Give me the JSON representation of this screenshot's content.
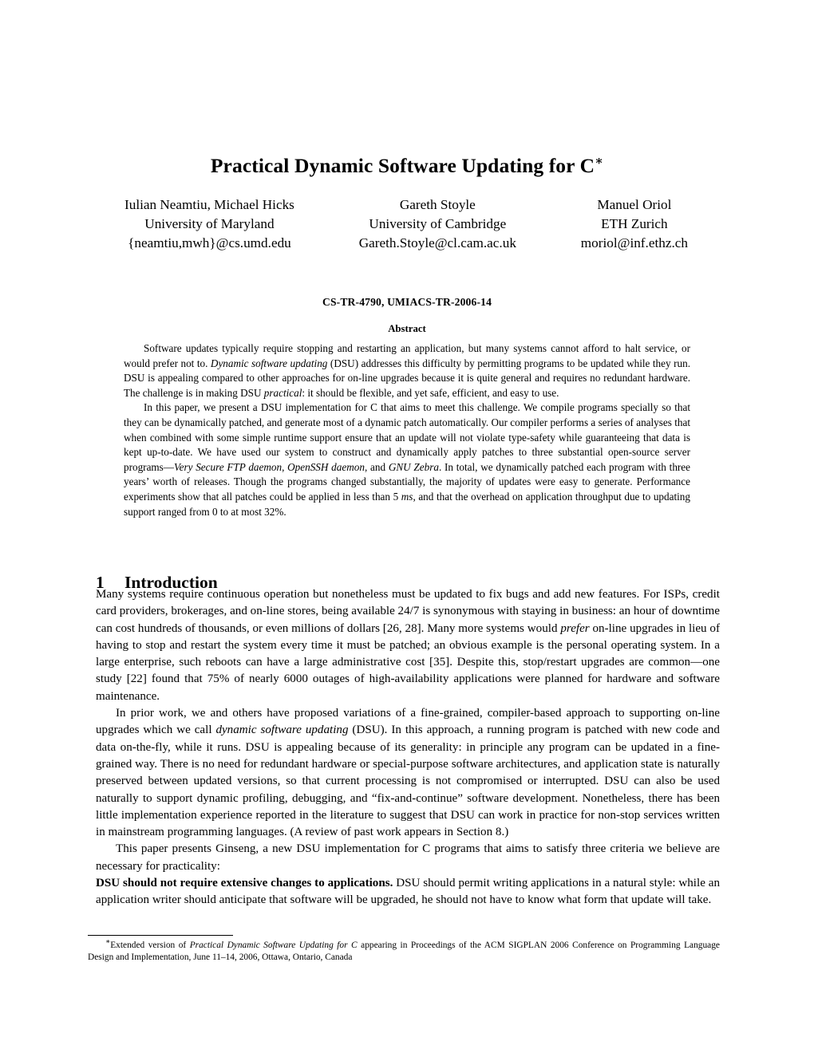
{
  "paper": {
    "title": "Practical Dynamic Software Updating for C",
    "title_footnote_marker": "∗",
    "authors": [
      {
        "names": "Iulian Neamtiu, Michael Hicks",
        "affiliation": "University of Maryland",
        "email": "{neamtiu,mwh}@cs.umd.edu"
      },
      {
        "names": "Gareth Stoyle",
        "affiliation": "University of Cambridge",
        "email": "Gareth.Stoyle@cl.cam.ac.uk"
      },
      {
        "names": "Manuel Oriol",
        "affiliation": "ETH Zurich",
        "email": "moriol@inf.ethz.ch"
      }
    ],
    "report_number": "CS-TR-4790, UMIACS-TR-2006-14",
    "abstract_heading": "Abstract",
    "abstract_paragraphs": [
      "Software updates typically require stopping and restarting an application, but many systems cannot afford to halt service, or would prefer not to. <i>Dynamic software updating</i> (DSU) addresses this difficulty by permitting programs to be updated while they run. DSU is appealing compared to other approaches for on-line upgrades because it is quite general and requires no redundant hardware. The challenge is in making DSU <i>practical</i>: it should be flexible, and yet safe, efficient, and easy to use.",
      "In this paper, we present a DSU implementation for C that aims to meet this challenge. We compile programs specially so that they can be dynamically patched, and generate most of a dynamic patch automatically. Our compiler performs a series of analyses that when combined with some simple runtime support ensure that an update will not violate type-safety while guaranteeing that data is kept up-to-date. We have used our system to construct and dynamically apply patches to three substantial open-source server programs—<i>Very Secure FTP daemon</i>, <i>OpenSSH daemon</i>, and <i>GNU Zebra</i>. In total, we dynamically patched each program with three years’ worth of releases. Though the programs changed substantially, the majority of updates were easy to generate. Performance experiments show that all patches could be applied in less than 5 <i>ms</i>, and that the overhead on application throughput due to updating support ranged from 0 to at most 32%."
    ],
    "section": {
      "number": "1",
      "title": "Introduction"
    },
    "body_paragraphs": [
      "Many systems require continuous operation but nonetheless must be updated to fix bugs and add new features. For ISPs, credit card providers, brokerages, and on-line stores, being available 24/7 is synonymous with staying in business: an hour of downtime can cost hundreds of thousands, or even millions of dollars [26, 28]. Many more systems would <i>prefer</i> on-line upgrades in lieu of having to stop and restart the system every time it must be patched; an obvious example is the personal operating system. In a large enterprise, such reboots can have a large administrative cost [35]. Despite this, stop/restart upgrades are common—one study [22] found that 75% of nearly 6000 outages of high-availability applications were planned for hardware and software maintenance.",
      "In prior work, we and others have proposed variations of a fine-grained, compiler-based approach to supporting on-line upgrades which we call <i>dynamic software updating</i> (DSU). In this approach, a running program is patched with new code and data on-the-fly, while it runs. DSU is appealing because of its generality: in principle any program can be updated in a fine-grained way. There is no need for redundant hardware or special-purpose software architectures, and application state is naturally preserved between updated versions, so that current processing is not compromised or interrupted. DSU can also be used naturally to support dynamic profiling, debugging, and “fix-and-continue” software development. Nonetheless, there has been little implementation experience reported in the literature to suggest that DSU can work in practice for non-stop services written in mainstream programming languages. (A review of past work appears in Section 8.)",
      "This paper presents Ginseng, a new DSU implementation for C programs that aims to satisfy three criteria we believe are necessary for practicality:"
    ],
    "criterion_paragraph": {
      "lead": "DSU should not require extensive changes to applications.",
      "rest": " DSU should permit writing applications in a natural style: while an application writer should anticipate that software will be upgraded, he should not have to know what form that update will take."
    },
    "footnote": "<sup>∗</sup>Extended version of <i>Practical Dynamic Software Updating for C</i> appearing in Proceedings of the ACM SIGPLAN 2006 Conference on Programming Language Design and Implementation, June 11–14, 2006, Ottawa, Ontario, Canada"
  }
}
